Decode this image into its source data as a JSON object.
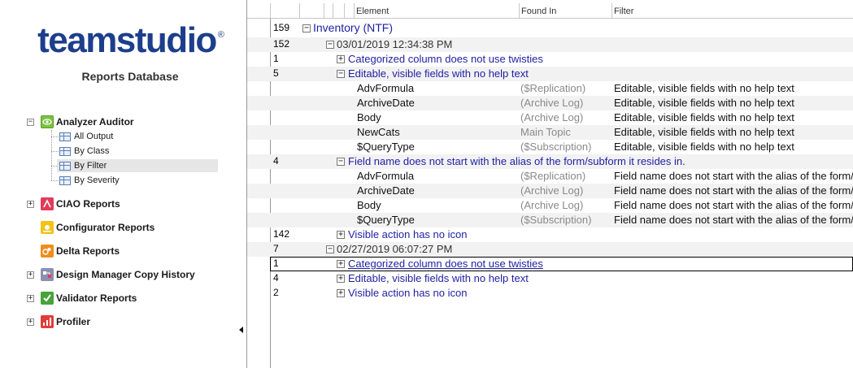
{
  "app": {
    "logo_text": "teamstudio",
    "logo_mark": "®",
    "database_title": "Reports Database"
  },
  "nav": {
    "items": [
      {
        "label": "Analyzer Auditor",
        "twistie": "−",
        "icon": "analyzer-eye-icon",
        "color": "#7cc242"
      },
      {
        "label": "CIAO Reports",
        "twistie": "+",
        "icon": "ciao-icon",
        "color": "#e23b5a"
      },
      {
        "label": "Configurator Reports",
        "twistie": "",
        "icon": "configurator-icon",
        "color": "#f2c318"
      },
      {
        "label": "Delta Reports",
        "twistie": "",
        "icon": "delta-icon",
        "color": "#f28c1c"
      },
      {
        "label": "Design Manager Copy History",
        "twistie": "+",
        "icon": "design-manager-icon",
        "color": "#8b8fb3"
      },
      {
        "label": "Validator Reports",
        "twistie": "+",
        "icon": "validator-check-icon",
        "color": "#47a33a"
      },
      {
        "label": "Profiler",
        "twistie": "+",
        "icon": "profiler-icon",
        "color": "#e23b3b"
      }
    ],
    "sub_items": [
      {
        "label": "All Output"
      },
      {
        "label": "By Class"
      },
      {
        "label": "By Filter",
        "selected": true
      },
      {
        "label": "By Severity"
      }
    ]
  },
  "view": {
    "columns": [
      "Element",
      "Found In",
      "Filter"
    ],
    "rows": [
      {
        "count": "159",
        "twistie": "−",
        "category": "Inventory (NTF)",
        "level": 0
      },
      {
        "count": "152",
        "twistie": "−",
        "category": "03/01/2019 12:34:38 PM",
        "level": 1,
        "kind": "date"
      },
      {
        "count": "1",
        "twistie": "+",
        "category": "Categorized column does not use twisties",
        "level": 2
      },
      {
        "count": "5",
        "twistie": "−",
        "category": "Editable, visible fields with no help text",
        "level": 2
      },
      {
        "element": "AdvFormula",
        "found_in": "($Replication)",
        "filter": "Editable, visible fields with no help text"
      },
      {
        "element": "ArchiveDate",
        "found_in": "(Archive Log)",
        "filter": "Editable, visible fields with no help text"
      },
      {
        "element": "Body",
        "found_in": "(Archive Log)",
        "filter": "Editable, visible fields with no help text"
      },
      {
        "element": "NewCats",
        "found_in": "Main Topic",
        "filter": "Editable, visible fields with no help text"
      },
      {
        "element": "$QueryType",
        "found_in": "($Subscription)",
        "filter": "Editable, visible fields with no help text"
      },
      {
        "count": "4",
        "twistie": "−",
        "category": "Field name does not start with the alias of the form/subform it resides in.",
        "level": 2
      },
      {
        "element": "AdvFormula",
        "found_in": "($Replication)",
        "filter": "Field name does not start with the alias of the form/"
      },
      {
        "element": "ArchiveDate",
        "found_in": "(Archive Log)",
        "filter": "Field name does not start with the alias of the form/"
      },
      {
        "element": "Body",
        "found_in": "(Archive Log)",
        "filter": "Field name does not start with the alias of the form/"
      },
      {
        "element": "$QueryType",
        "found_in": "($Subscription)",
        "filter": "Field name does not start with the alias of the form/"
      },
      {
        "count": "142",
        "twistie": "+",
        "category": "Visible action has no icon",
        "level": 2
      },
      {
        "count": "7",
        "twistie": "−",
        "category": "02/27/2019 06:07:27 PM",
        "level": 1,
        "kind": "date"
      },
      {
        "count": "1",
        "twistie": "+",
        "category": "Categorized column does not use twisties",
        "level": 2,
        "focused": true
      },
      {
        "count": "4",
        "twistie": "+",
        "category": "Editable, visible fields with no help text",
        "level": 2
      },
      {
        "count": "2",
        "twistie": "+",
        "category": "Visible action has no icon",
        "level": 2
      }
    ]
  }
}
